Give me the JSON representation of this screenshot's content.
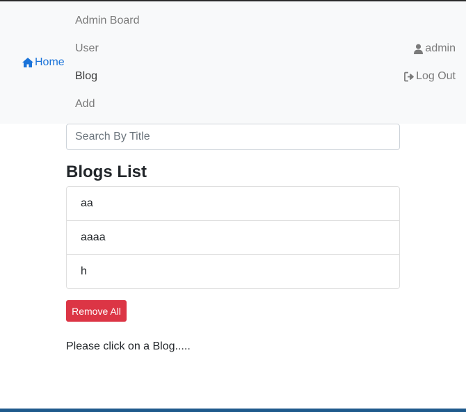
{
  "nav": {
    "brand_label": "Home",
    "links": [
      {
        "label": "Admin Board"
      },
      {
        "label": "User"
      },
      {
        "label": "Blog"
      },
      {
        "label": "Add"
      }
    ],
    "user_label": "admin",
    "logout_label": "Log Out",
    "active_link": "Blog"
  },
  "search": {
    "placeholder": "Search By Title",
    "value": ""
  },
  "blogs": {
    "heading": "Blogs List",
    "items": [
      {
        "title": "aa"
      },
      {
        "title": "aaaa"
      },
      {
        "title": "h"
      }
    ],
    "remove_all_label": "Remove All",
    "message": "Please click on a Blog....."
  },
  "colors": {
    "brand": "#1a73d9",
    "danger": "#dc3545",
    "navbar_bg": "#f8f9fa"
  },
  "icons": {
    "brand": "home-icon",
    "user": "user-icon",
    "logout": "sign-out-icon"
  }
}
